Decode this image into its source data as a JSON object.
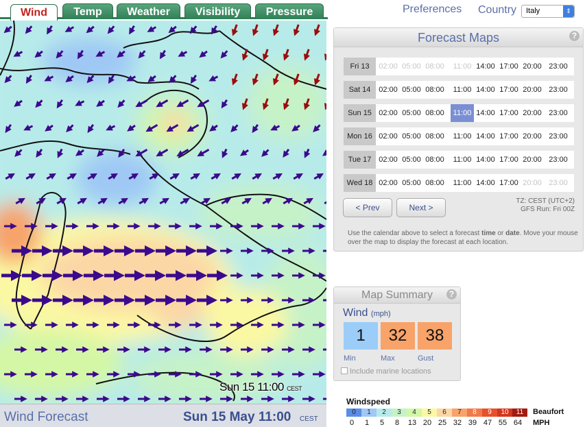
{
  "tabs": [
    {
      "label": "Wind",
      "active": true
    },
    {
      "label": "Temp",
      "active": false
    },
    {
      "label": "Weather",
      "active": false
    },
    {
      "label": "Visibility",
      "active": false
    },
    {
      "label": "Pressure",
      "active": false
    }
  ],
  "header": {
    "preferences_label": "Preferences",
    "country_label": "Country",
    "country_value": "Italy"
  },
  "map": {
    "stamp_time": "Sun 15 11:00",
    "stamp_tz": "CEST"
  },
  "bottom_bar": {
    "title": "Wind Forecast",
    "date": "Sun 15 May 11:00",
    "tz": "CEST"
  },
  "forecast_panel": {
    "title": "Forecast Maps",
    "help": "?",
    "times": [
      "02:00",
      "05:00",
      "08:00",
      "11:00",
      "14:00",
      "17:00",
      "20:00",
      "23:00"
    ],
    "days": [
      {
        "label": "Fri 13",
        "available": [
          false,
          false,
          false,
          false,
          true,
          true,
          true,
          true
        ]
      },
      {
        "label": "Sat 14",
        "available": [
          true,
          true,
          true,
          true,
          true,
          true,
          true,
          true
        ]
      },
      {
        "label": "Sun 15",
        "available": [
          true,
          true,
          true,
          true,
          true,
          true,
          true,
          true
        ],
        "selected_index": 3
      },
      {
        "label": "Mon 16",
        "available": [
          true,
          true,
          true,
          true,
          true,
          true,
          true,
          true
        ]
      },
      {
        "label": "Tue 17",
        "available": [
          true,
          true,
          true,
          true,
          true,
          true,
          true,
          true
        ]
      },
      {
        "label": "Wed 18",
        "available": [
          true,
          true,
          true,
          true,
          true,
          true,
          false,
          false
        ]
      }
    ],
    "prev_label": "< Prev",
    "next_label": "Next >",
    "tz_line": "TZ: CEST (UTC+2)",
    "gfs_line": "GFS Run: Fri 00Z",
    "help_text_1": "Use the calendar above to select a forecast ",
    "help_text_time": "time",
    "help_text_2": " or ",
    "help_text_date": "date",
    "help_text_3": ". Move your mouse over the map to display the forecast at each location."
  },
  "summary": {
    "title": "Map Summary",
    "help": "?",
    "variable": "Wind",
    "unit": "(mph)",
    "min_value": "1",
    "max_value": "32",
    "gust_value": "38",
    "min_label": "Min",
    "max_label": "Max",
    "gust_label": "Gust",
    "marine_label": "Include marine locations",
    "min_color": "#9bcdf8",
    "max_color": "#f7a36a",
    "gust_color": "#f7a36a"
  },
  "legend": {
    "title": "Windspeed",
    "beaufort_label": "Beaufort",
    "mph_label": "MPH",
    "beaufort": [
      "0",
      "1",
      "2",
      "3",
      "4",
      "5",
      "6",
      "7",
      "8",
      "9",
      "10",
      "11"
    ],
    "colors": [
      "#5a8de6",
      "#9fc8f5",
      "#b7ebe9",
      "#c6f2c8",
      "#d4f7a5",
      "#fbf8a3",
      "#fbd7a6",
      "#f7a36a",
      "#f07a4c",
      "#e8502a",
      "#d2361f",
      "#a11b10"
    ],
    "mph": [
      "0",
      "1",
      "5",
      "8",
      "13",
      "20",
      "25",
      "32",
      "39",
      "47",
      "55",
      "64"
    ]
  }
}
